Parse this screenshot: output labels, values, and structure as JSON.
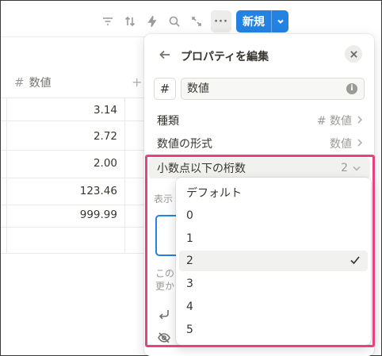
{
  "toolbar": {
    "icons": [
      "filter-icon",
      "sort-icon",
      "automation-icon",
      "search-icon",
      "expand-icon",
      "more-icon"
    ],
    "more_label": "···",
    "new_label": "新規"
  },
  "table": {
    "column_header": "数値",
    "rows": [
      "3.14",
      "2.72",
      "2.00",
      "123.46",
      "999.99"
    ]
  },
  "panel": {
    "title": "プロパティを編集",
    "type_symbol": "#",
    "name_value": "数値",
    "rows": [
      {
        "label": "種類",
        "value": "# 数値"
      },
      {
        "label": "数値の形式",
        "value": "数値"
      }
    ],
    "decimal_row": {
      "label": "小数点以下の桁数",
      "value": "2"
    },
    "partial_label": "表示",
    "partial_text_1": "この",
    "partial_text_2": "更か"
  },
  "dropdown": {
    "options": [
      "デフォルト",
      "0",
      "1",
      "2",
      "3",
      "4",
      "5"
    ],
    "selected": "2"
  },
  "colors": {
    "accent": "#2383e2",
    "highlight": "#e8417f"
  }
}
